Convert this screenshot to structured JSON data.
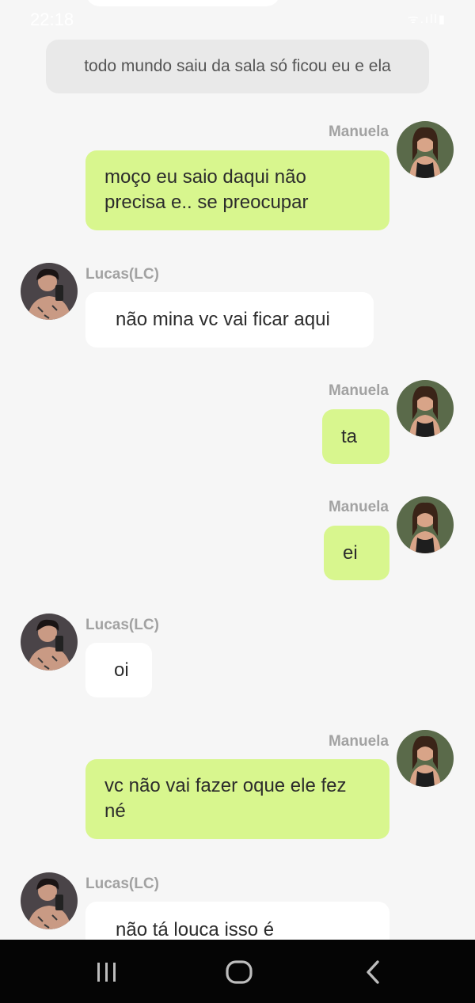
{
  "status_bar": {
    "time": "22:18",
    "icons": "wifi signal battery"
  },
  "narration": "todo mundo saiu da sala só ficou eu e ela",
  "messages": [
    {
      "sender": "Manuela",
      "text": "moço eu saio daqui não precisa e.. se preocupar"
    },
    {
      "sender": "Lucas(LC)",
      "text": "não mina vc vai ficar aqui"
    },
    {
      "sender": "Manuela",
      "text": "ta"
    },
    {
      "sender": "Manuela",
      "text": "ei"
    },
    {
      "sender": "Lucas(LC)",
      "text": "oi"
    },
    {
      "sender": "Manuela",
      "text": "vc não vai fazer oque ele fez né"
    },
    {
      "sender": "Lucas(LC)",
      "text": "não tá louca isso é"
    }
  ],
  "nav": {
    "recents": "recents-icon",
    "home": "home-icon",
    "back": "back-icon"
  },
  "colors": {
    "my_bubble": "#d8f68e",
    "their_bubble": "#ffffff",
    "background": "#f6f6f6"
  }
}
